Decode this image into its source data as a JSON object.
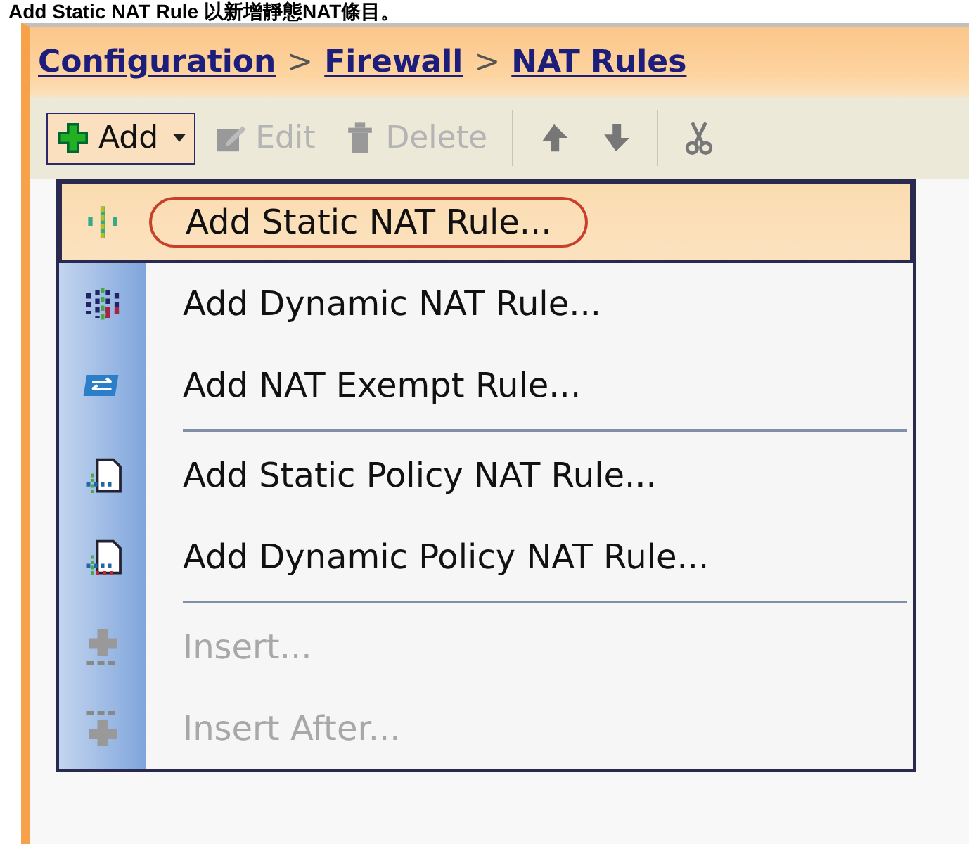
{
  "caption": "Add Static NAT Rule 以新增靜態NAT條目。",
  "breadcrumb": [
    "Configuration",
    "Firewall",
    "NAT Rules"
  ],
  "breadcrumb_separator": ">",
  "toolbar": [
    {
      "label": "Add",
      "kind": "dropdown",
      "disabled": false,
      "pressed": true
    },
    {
      "label": "Edit",
      "kind": "button",
      "disabled": true,
      "pressed": false
    },
    {
      "label": "Delete",
      "kind": "button",
      "disabled": true,
      "pressed": false
    },
    {
      "kind": "separator"
    },
    {
      "kind": "icon",
      "disabled": false,
      "pressed": false
    },
    {
      "kind": "icon",
      "disabled": false,
      "pressed": false
    },
    {
      "kind": "separator"
    },
    {
      "kind": "icon",
      "disabled": false,
      "pressed": false
    }
  ],
  "menu": [
    {
      "kind": "item",
      "label": "Add Static NAT Rule...",
      "selected": true,
      "disabled": false
    },
    {
      "kind": "item",
      "label": "Add Dynamic NAT Rule...",
      "selected": false,
      "disabled": false
    },
    {
      "kind": "item",
      "label": "Add NAT Exempt Rule...",
      "selected": false,
      "disabled": false
    },
    {
      "kind": "separator"
    },
    {
      "kind": "item",
      "label": "Add Static Policy NAT Rule...",
      "selected": false,
      "disabled": false
    },
    {
      "kind": "item",
      "label": "Add Dynamic Policy NAT Rule...",
      "selected": false,
      "disabled": false
    },
    {
      "kind": "separator"
    },
    {
      "kind": "item",
      "label": "Insert...",
      "selected": false,
      "disabled": true
    },
    {
      "kind": "item",
      "label": "Insert After...",
      "selected": false,
      "disabled": true
    }
  ]
}
